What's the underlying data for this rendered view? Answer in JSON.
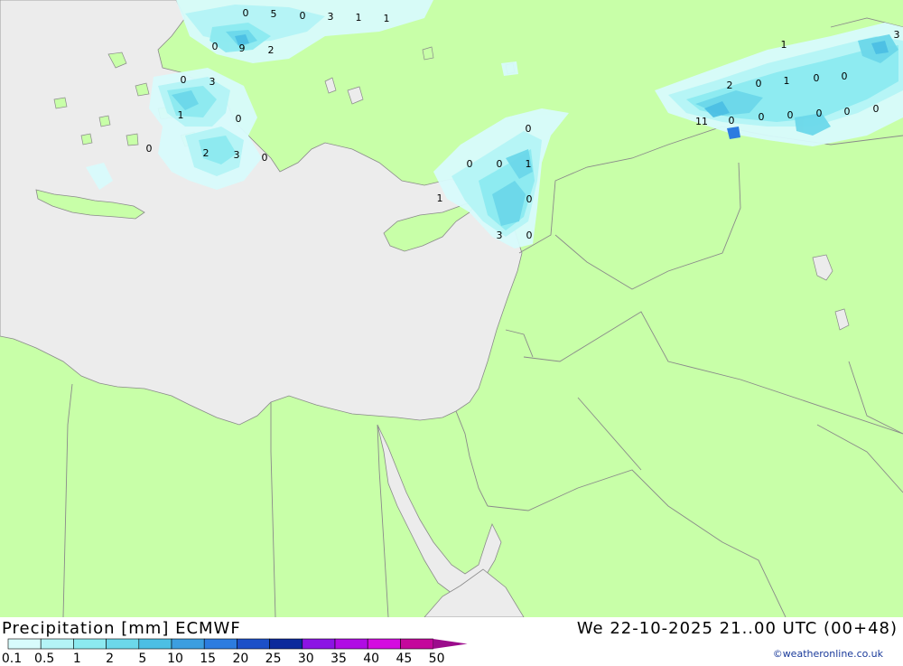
{
  "header": {
    "title": "Precipitation [mm] ECMWF",
    "valid_time": "We 22-10-2025 21..00 UTC (00+48)",
    "credit": "©weatheronline.co.uk"
  },
  "colors": {
    "land": "#c8ffa8",
    "sea": "#ececec",
    "border": "#8a8a8a"
  },
  "legend": {
    "ticks": [
      "0.1",
      "0.5",
      "1",
      "2",
      "5",
      "10",
      "15",
      "20",
      "25",
      "30",
      "35",
      "40",
      "45",
      "50"
    ],
    "colors": [
      "#d8fbfc",
      "#b4f4f6",
      "#8ceaf0",
      "#6cd8ea",
      "#4cbfe4",
      "#3c9ee0",
      "#2c7ce0",
      "#1c50c8",
      "#0c2a9c",
      "#8c14e4",
      "#b00ce4",
      "#d40ce0",
      "#c4089c"
    ]
  },
  "precip_values": [
    {
      "text": "0"
    },
    {
      "text": "5"
    },
    {
      "text": "0"
    },
    {
      "text": "3"
    },
    {
      "text": "1"
    },
    {
      "text": "1"
    },
    {
      "text": "0"
    },
    {
      "text": "9"
    },
    {
      "text": "2"
    },
    {
      "text": "0"
    },
    {
      "text": "3"
    },
    {
      "text": "1"
    },
    {
      "text": "0"
    },
    {
      "text": "0"
    },
    {
      "text": "2"
    },
    {
      "text": "3"
    },
    {
      "text": "0"
    },
    {
      "text": "0"
    },
    {
      "text": "0"
    },
    {
      "text": "0"
    },
    {
      "text": "1"
    },
    {
      "text": "1"
    },
    {
      "text": "0"
    },
    {
      "text": "3"
    },
    {
      "text": "0"
    },
    {
      "text": "1"
    },
    {
      "text": "3"
    },
    {
      "text": "2"
    },
    {
      "text": "0"
    },
    {
      "text": "1"
    },
    {
      "text": "0"
    },
    {
      "text": "0"
    },
    {
      "text": "11"
    },
    {
      "text": "0"
    },
    {
      "text": "0"
    },
    {
      "text": "0"
    },
    {
      "text": "0"
    },
    {
      "text": "0"
    },
    {
      "text": "0"
    }
  ]
}
